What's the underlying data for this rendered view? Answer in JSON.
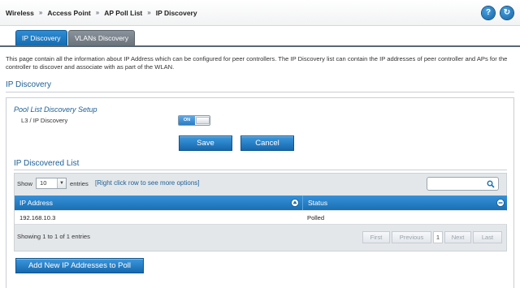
{
  "breadcrumb": [
    "Wireless",
    "Access Point",
    "AP Poll List",
    "IP Discovery"
  ],
  "breadcrumb_separator": "»",
  "header_icons": {
    "help": "?",
    "logout": "↻"
  },
  "tabs": [
    {
      "label": "IP Discovery",
      "active": true
    },
    {
      "label": "VLANs Discovery",
      "active": false
    }
  ],
  "description": "This page contain all the information about IP Address which can be configured for peer controllers. The IP Discovery list can contain the IP addresses of peer controller and APs for the controller to discover and associate with as part of the WLAN.",
  "section_title": "IP Discovery",
  "setup": {
    "heading": "Pool List Discovery Setup",
    "field_label": "L3 / IP Discovery",
    "toggle_label": "ON",
    "toggle_on": true
  },
  "buttons": {
    "save": "Save",
    "cancel": "Cancel",
    "add": "Add New IP Addresses to Poll"
  },
  "list": {
    "title": "IP Discovered List",
    "show_label": "Show",
    "entries_value": "10",
    "entries_label": "entries",
    "hint": "[Right click row to see more options]",
    "columns": [
      "IP Address",
      "Status"
    ],
    "rows": [
      {
        "ip": "192.168.10.3",
        "status": "Polled"
      }
    ],
    "info": "Showing 1 to 1 of 1 entries",
    "pagination": {
      "first": "First",
      "previous": "Previous",
      "current": "1",
      "next": "Next",
      "last": "Last"
    }
  },
  "colors": {
    "accent": "#1a6fb3",
    "heading": "#1c5f95",
    "tab_inactive": "#6b747c"
  }
}
